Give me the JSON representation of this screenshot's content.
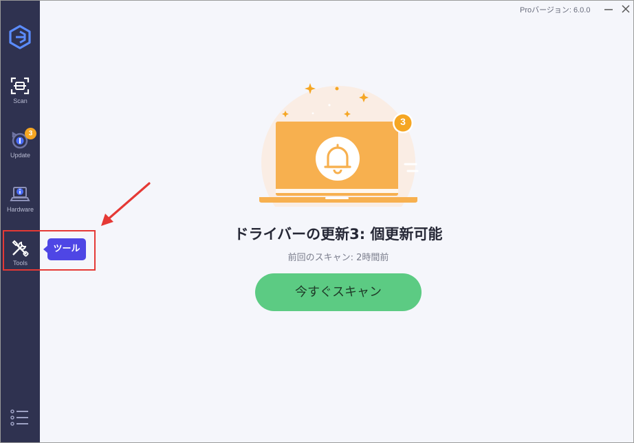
{
  "app": {
    "version_text": "Proバージョン: 6.0.0",
    "minimize_icon": "minimize-icon",
    "close_icon": "close-icon"
  },
  "sidebar": {
    "logo_icon": "app-logo-icon",
    "items": [
      {
        "label": "Scan",
        "icon": "scan-icon"
      },
      {
        "label": "Update",
        "icon": "update-icon",
        "badge": "3"
      },
      {
        "label": "Hardware",
        "icon": "hardware-icon"
      },
      {
        "label": "Tools",
        "icon": "tools-icon"
      }
    ],
    "menu_icon": "list-menu-icon"
  },
  "tooltip": {
    "text": "ツール"
  },
  "main": {
    "illustration_badge": "3",
    "heading": "ドライバーの更新3: 個更新可能",
    "last_scan": "前回のスキャン: 2時間前",
    "scan_button": "今すぐスキャン"
  },
  "colors": {
    "sidebar_bg": "#2f3250",
    "accent_orange": "#f5a623",
    "scan_green": "#5ccb83",
    "tooltip_purple": "#4e46e5",
    "highlight_red": "#e53935"
  }
}
